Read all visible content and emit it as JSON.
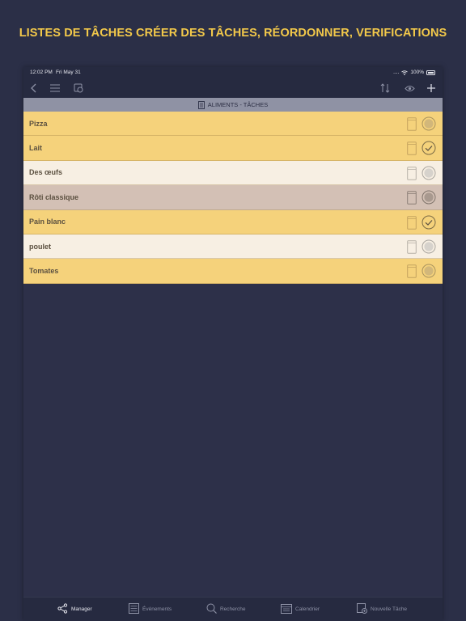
{
  "promo": {
    "title": "LISTES DE TÂCHES CRÉER DES TÂCHES, RÉORDONNER, VERIFICATIONS"
  },
  "status": {
    "time": "12:02 PM",
    "date": "Fri May 31",
    "signal": "....",
    "battery": "100%"
  },
  "toolbar": {
    "left_icons": [
      "back-icon",
      "menu-icon",
      "sync-icon"
    ],
    "right_icons": [
      "sort-icon",
      "eye-icon",
      "plus-icon"
    ]
  },
  "list": {
    "title": "ALIMENTS - TÂCHES",
    "items": [
      {
        "label": "Pizza",
        "color": "#f5d27b",
        "done": false
      },
      {
        "label": "Lait",
        "color": "#f5d27b",
        "done": true
      },
      {
        "label": "Des œufs",
        "color": "#f7efe3",
        "done": false
      },
      {
        "label": "Rôti classique",
        "color": "#d3c0b5",
        "done": false
      },
      {
        "label": "Pain blanc",
        "color": "#f5d27b",
        "done": true
      },
      {
        "label": "poulet",
        "color": "#f7efe3",
        "done": false
      },
      {
        "label": "Tomates",
        "color": "#f5d27b",
        "done": false
      }
    ]
  },
  "tabs": [
    {
      "label": "Manager",
      "icon": "share-icon",
      "active": true
    },
    {
      "label": "Événements",
      "icon": "list-icon",
      "active": false
    },
    {
      "label": "Recherche",
      "icon": "search-icon",
      "active": false
    },
    {
      "label": "Calendrier",
      "icon": "calendar-icon",
      "active": false
    },
    {
      "label": "Nouvelle Tâche",
      "icon": "new-task-icon",
      "active": false
    }
  ]
}
